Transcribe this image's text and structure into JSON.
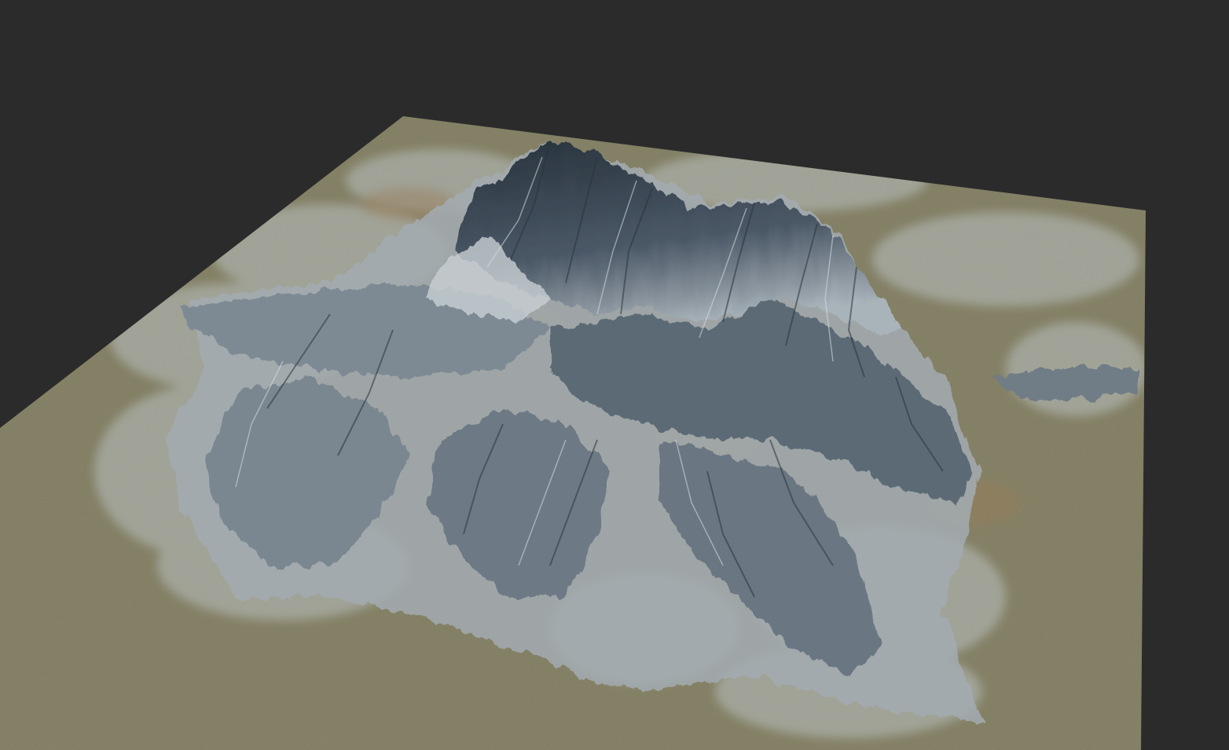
{
  "viewport": {
    "background_color": "#2b2b2b"
  },
  "terrain": {
    "ground_color": "#7d7a5e",
    "ground_light_color": "#8f8a6c",
    "rock_light_color": "#c5ccd0",
    "rock_dark_color": "#3e4a55",
    "rock_shadow_color": "#26313b",
    "soil_color": "#9a7d5a"
  }
}
